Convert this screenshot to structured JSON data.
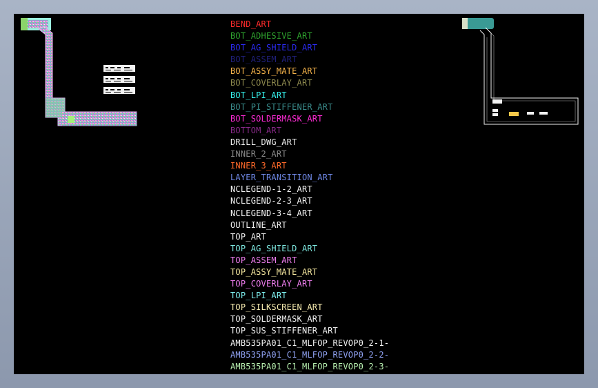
{
  "colors": {
    "canvas_background": "#000000",
    "frame_background": "#9aa6b8"
  },
  "layers": [
    {
      "name": "BEND_ART",
      "color": "#ff2b2b"
    },
    {
      "name": "BOT_ADHESIVE_ART",
      "color": "#2fa52f"
    },
    {
      "name": "BOT_AG_SHIELD_ART",
      "color": "#2a2af0"
    },
    {
      "name": "BOT_ASSEM_ART",
      "color": "#20207a"
    },
    {
      "name": "BOT_ASSY_MATE_ART",
      "color": "#f5b34a"
    },
    {
      "name": "BOT_COVERLAY_ART",
      "color": "#8e8a4e"
    },
    {
      "name": "BOT_LPI_ART",
      "color": "#36f2ee"
    },
    {
      "name": "BOT_PI_STIFFENER_ART",
      "color": "#3a8c8c"
    },
    {
      "name": "BOT_SOLDERMASK_ART",
      "color": "#ff2bd6"
    },
    {
      "name": "BOTTOM_ART",
      "color": "#8a2a8a"
    },
    {
      "name": "DRILL_DWG_ART",
      "color": "#ececec"
    },
    {
      "name": "INNER_2_ART",
      "color": "#8a8a8a"
    },
    {
      "name": "INNER_3_ART",
      "color": "#ff6a2a"
    },
    {
      "name": "LAYER_TRANSITION_ART",
      "color": "#6f88e6"
    },
    {
      "name": "NCLEGEND-1-2_ART",
      "color": "#f2f2f2"
    },
    {
      "name": "NCLEGEND-2-3_ART",
      "color": "#f2f2f2"
    },
    {
      "name": "NCLEGEND-3-4_ART",
      "color": "#f2f2f2"
    },
    {
      "name": "OUTLINE_ART",
      "color": "#f2f2f2"
    },
    {
      "name": "TOP_ART",
      "color": "#f2f2f2"
    },
    {
      "name": "TOP_AG_SHIELD_ART",
      "color": "#7ee8e0"
    },
    {
      "name": "TOP_ASSEM_ART",
      "color": "#f07ef0"
    },
    {
      "name": "TOP_ASSY_MATE_ART",
      "color": "#f7e9a0"
    },
    {
      "name": "TOP_COVERLAY_ART",
      "color": "#f07ef0"
    },
    {
      "name": "TOP_LPI_ART",
      "color": "#7ef0f0"
    },
    {
      "name": "TOP_SILKSCREEN_ART",
      "color": "#f7ecb0"
    },
    {
      "name": "TOP_SOLDERMASK_ART",
      "color": "#f2f2f2"
    },
    {
      "name": "TOP_SUS_STIFFENER_ART",
      "color": "#f2f2f2"
    },
    {
      "name": "AMB535PA01_C1_MLFOP_REVOP0_2-1-",
      "color": "#f2f2f2"
    },
    {
      "name": "AMB535PA01_C1_MLFOP_REVOP0_2-2-",
      "color": "#8ea0f0"
    },
    {
      "name": "AMB535PA01_C1_MLFOP_REVOP0_2-3-",
      "color": "#b8f0b0"
    }
  ]
}
